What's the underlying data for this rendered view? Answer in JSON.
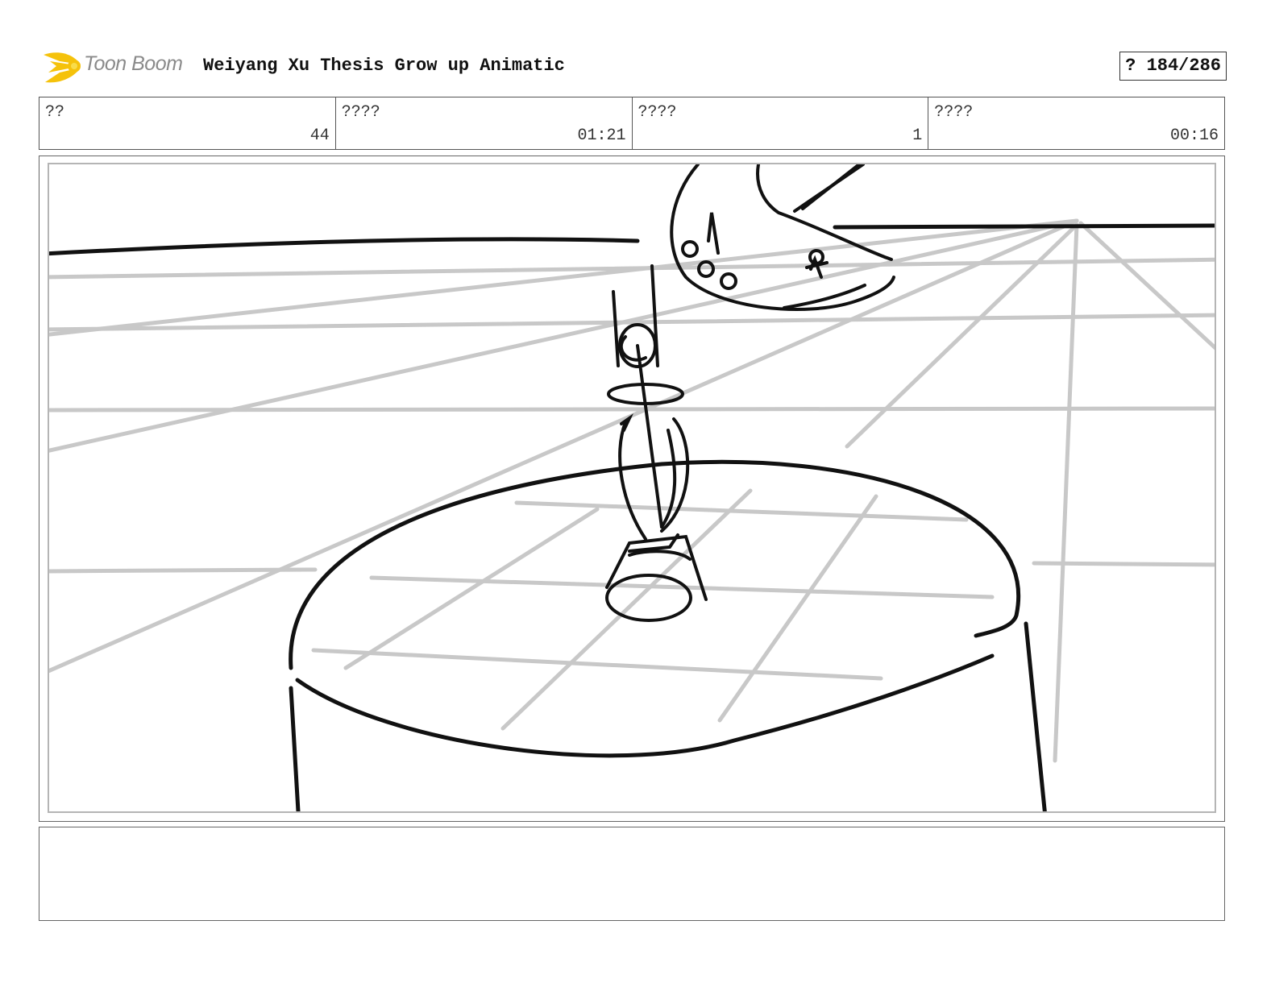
{
  "header": {
    "brand": "Toon Boom",
    "title": "Weiyang Xu Thesis Grow up Animatic",
    "page_counter": "? 184/286"
  },
  "info": [
    {
      "label": "??",
      "value": "44"
    },
    {
      "label": "????",
      "value": "01:21"
    },
    {
      "label": "????",
      "value": "1"
    },
    {
      "label": "????",
      "value": "00:16"
    }
  ],
  "notes": {
    "text": ""
  },
  "icons": {
    "logo": "toon-boom-flame-icon",
    "logo_color": "#f5c20b"
  }
}
